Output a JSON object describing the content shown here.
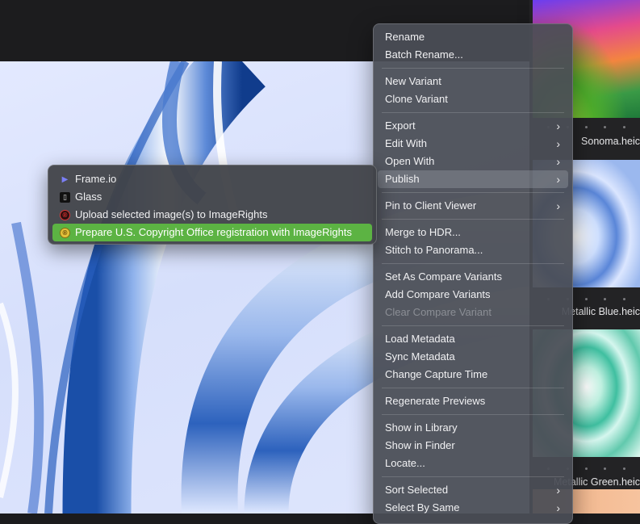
{
  "filmstrip": {
    "captions": [
      "Sonoma.heic",
      "Metallic Blue.heic",
      "Metallic Green.heic"
    ]
  },
  "context_menu": {
    "items": [
      {
        "label": "Rename"
      },
      {
        "label": "Batch Rename..."
      },
      {
        "label": "New Variant"
      },
      {
        "label": "Clone Variant"
      },
      {
        "label": "Export",
        "submenu": true
      },
      {
        "label": "Edit With",
        "submenu": true
      },
      {
        "label": "Open With",
        "submenu": true
      },
      {
        "label": "Publish",
        "submenu": true,
        "active": true
      },
      {
        "label": "Pin to Client Viewer",
        "submenu": true
      },
      {
        "label": "Merge to HDR..."
      },
      {
        "label": "Stitch to Panorama..."
      },
      {
        "label": "Set As Compare Variants"
      },
      {
        "label": "Add Compare Variants"
      },
      {
        "label": "Clear Compare Variant",
        "disabled": true
      },
      {
        "label": "Load Metadata"
      },
      {
        "label": "Sync Metadata"
      },
      {
        "label": "Change Capture Time"
      },
      {
        "label": "Regenerate Previews"
      },
      {
        "label": "Show in Library"
      },
      {
        "label": "Show in Finder"
      },
      {
        "label": "Locate..."
      },
      {
        "label": "Sort Selected",
        "submenu": true
      },
      {
        "label": "Select By Same",
        "submenu": true
      }
    ],
    "chevron": "›"
  },
  "publish_submenu": {
    "items": [
      {
        "label": "Frame.io",
        "icon": "frameio-icon"
      },
      {
        "label": "Glass",
        "icon": "glass-icon"
      },
      {
        "label": "Upload selected image(s) to ImageRights",
        "icon": "imagerights-icon"
      },
      {
        "label": "Prepare U.S. Copyright Office registration with ImageRights",
        "icon": "imagerights-copyright-icon",
        "highlighted": true
      }
    ],
    "highlight_color": "#5cb343"
  }
}
